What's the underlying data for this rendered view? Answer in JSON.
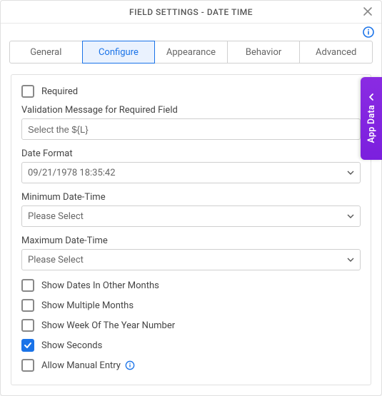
{
  "title": "FIELD SETTINGS - DATE TIME",
  "tabs": {
    "general": "General",
    "configure": "Configure",
    "appearance": "Appearance",
    "behavior": "Behavior",
    "advanced": "Advanced"
  },
  "sidepanel": {
    "label": "App Data"
  },
  "configure": {
    "required_label": "Required",
    "validation_label": "Validation Message for Required Field",
    "validation_value": "Select the ${L}",
    "date_format_label": "Date Format",
    "date_format_value": "09/21/1978 18:35:42",
    "min_label": "Minimum Date-Time",
    "min_value": "Please Select",
    "max_label": "Maximum Date-Time",
    "max_value": "Please Select",
    "show_other_months": "Show Dates In Other Months",
    "show_multiple_months": "Show Multiple Months",
    "show_week_number": "Show Week Of The Year Number",
    "show_seconds": "Show Seconds",
    "allow_manual_entry": "Allow Manual Entry"
  }
}
